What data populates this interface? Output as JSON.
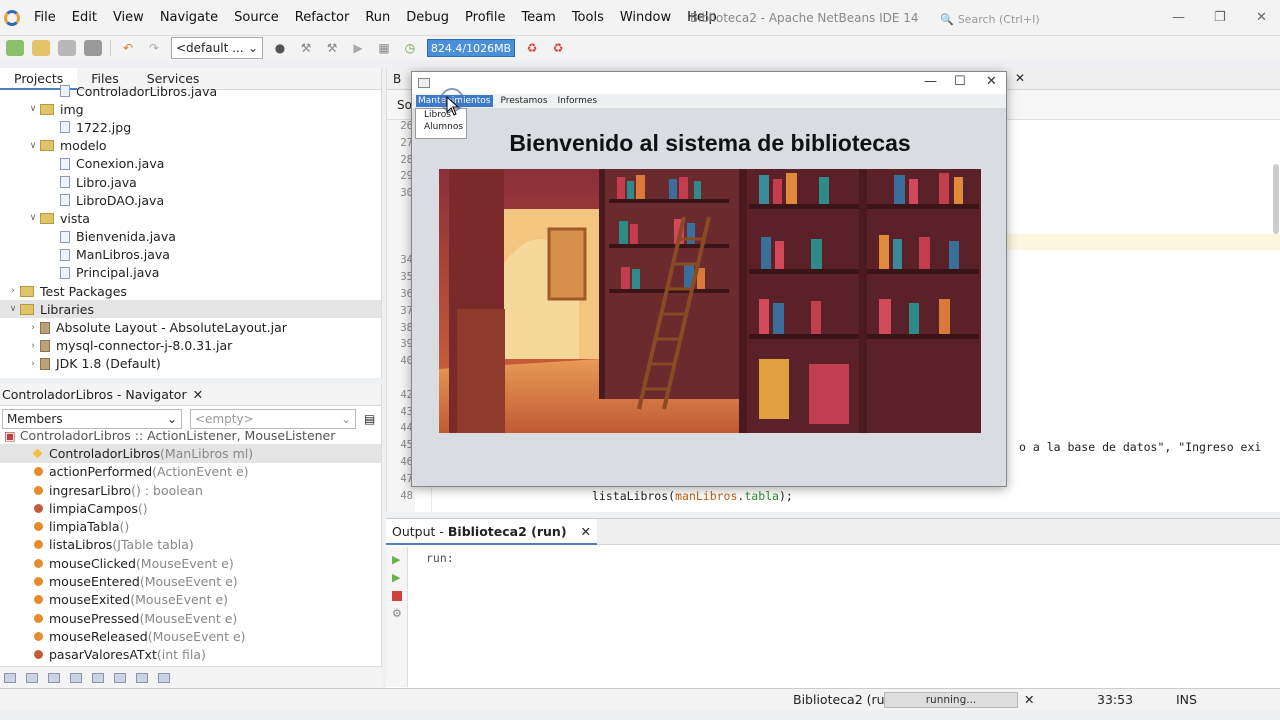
{
  "ide": {
    "window_title": "Biblioteca2 - Apache NetBeans IDE 14",
    "search_placeholder": "Search (Ctrl+I)",
    "menu": [
      "File",
      "Edit",
      "View",
      "Navigate",
      "Source",
      "Refactor",
      "Run",
      "Debug",
      "Profile",
      "Team",
      "Tools",
      "Window",
      "Help"
    ]
  },
  "toolbar": {
    "config": "<default ...",
    "memory": "824.4/1026MB"
  },
  "projects": {
    "tabs": [
      "Projects",
      "Files",
      "Services"
    ],
    "tree": [
      {
        "label": "ControladorLibros.java",
        "type": "file",
        "level": 3
      },
      {
        "label": "img",
        "type": "folder",
        "level": 2,
        "open": true
      },
      {
        "label": "1722.jpg",
        "type": "file",
        "level": 3
      },
      {
        "label": "modelo",
        "type": "folder",
        "level": 2,
        "open": true
      },
      {
        "label": "Conexion.java",
        "type": "file",
        "level": 3
      },
      {
        "label": "Libro.java",
        "type": "file",
        "level": 3
      },
      {
        "label": "LibroDAO.java",
        "type": "file",
        "level": 3
      },
      {
        "label": "vista",
        "type": "folder",
        "level": 2,
        "open": true
      },
      {
        "label": "Bienvenida.java",
        "type": "file",
        "level": 3
      },
      {
        "label": "ManLibros.java",
        "type": "file",
        "level": 3
      },
      {
        "label": "Principal.java",
        "type": "file",
        "level": 3
      },
      {
        "label": "Test Packages",
        "type": "folder",
        "level": 1,
        "open": false
      },
      {
        "label": "Libraries",
        "type": "folder",
        "level": 1,
        "open": true,
        "selected": true
      },
      {
        "label": "Absolute Layout - AbsoluteLayout.jar",
        "type": "jar",
        "level": 2,
        "open": false
      },
      {
        "label": "mysql-connector-j-8.0.31.jar",
        "type": "jar",
        "level": 2,
        "open": false
      },
      {
        "label": "JDK 1.8 (Default)",
        "type": "jar",
        "level": 2,
        "open": false
      }
    ]
  },
  "navigator": {
    "title": "ControladorLibros - Navigator",
    "filter": "Members",
    "empty": "<empty>",
    "root": "ControladorLibros :: ActionListener, MouseListener",
    "members": [
      {
        "name": "ControladorLibros",
        "sig": "(ManLibros ml)",
        "kind": "ctor",
        "selected": true
      },
      {
        "name": "actionPerformed",
        "sig": "(ActionEvent e)",
        "kind": "method"
      },
      {
        "name": "ingresarLibro",
        "sig": "() : boolean",
        "kind": "method"
      },
      {
        "name": "limpiaCampos",
        "sig": "()",
        "kind": "priv"
      },
      {
        "name": "limpiaTabla",
        "sig": "()",
        "kind": "method"
      },
      {
        "name": "listaLibros",
        "sig": "(JTable tabla)",
        "kind": "method"
      },
      {
        "name": "mouseClicked",
        "sig": "(MouseEvent e)",
        "kind": "method"
      },
      {
        "name": "mouseEntered",
        "sig": "(MouseEvent e)",
        "kind": "method"
      },
      {
        "name": "mouseExited",
        "sig": "(MouseEvent e)",
        "kind": "method"
      },
      {
        "name": "mousePressed",
        "sig": "(MouseEvent e)",
        "kind": "method"
      },
      {
        "name": "mouseReleased",
        "sig": "(MouseEvent e)",
        "kind": "method"
      },
      {
        "name": "pasarValoresATxt",
        "sig": "(int fila)",
        "kind": "priv"
      }
    ]
  },
  "editor": {
    "tab_partial": "B",
    "source_tab": "So",
    "line_numbers": [
      "26",
      "27",
      "28",
      "29",
      "30",
      "",
      "",
      "",
      "34",
      "35",
      "36",
      "37",
      "38",
      "39",
      "40",
      "",
      "42",
      "43",
      "44",
      "45",
      "46",
      "47",
      "48"
    ],
    "code_right": "o a la base de datos\", \"Ingreso exi",
    "code_line_48": "listaLibros(manLibros.tabla);"
  },
  "output": {
    "tab_label": "Output - ",
    "tab_bold": "Biblioteca2 (run)",
    "text": "run:"
  },
  "status": {
    "project": "Biblioteca2 (run)",
    "progress": "running...",
    "position": "33:53",
    "mode": "INS"
  },
  "app_window": {
    "menus": [
      "Mantenimientos",
      "Prestamos",
      "Informes"
    ],
    "dropdown": [
      "Libros",
      "Alumnos"
    ],
    "heading": "Bienvenido al sistema de bibliotecas"
  }
}
